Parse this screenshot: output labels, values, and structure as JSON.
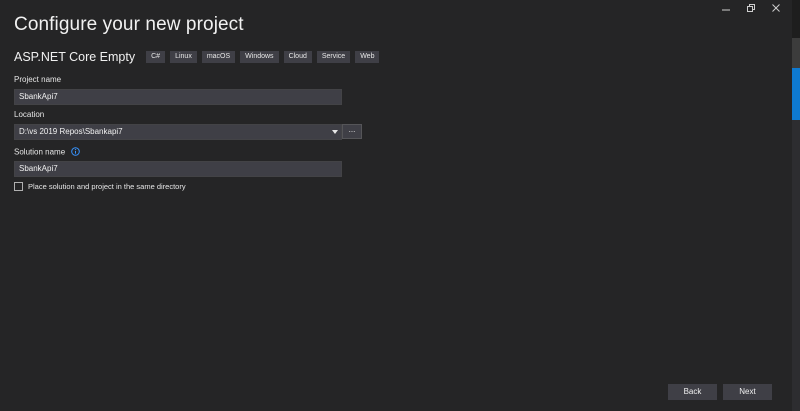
{
  "window": {
    "controls": {
      "minimize_icon": "minimize-icon",
      "maximize_icon": "restore-icon",
      "close_icon": "close-icon"
    }
  },
  "page": {
    "title": "Configure your new project"
  },
  "template": {
    "name": "ASP.NET Core Empty",
    "tags": [
      "C#",
      "Linux",
      "macOS",
      "Windows",
      "Cloud",
      "Service",
      "Web"
    ]
  },
  "form": {
    "project_name": {
      "label": "Project name",
      "value": "SbankApi7"
    },
    "location": {
      "label": "Location",
      "value": "D:\\vs 2019 Repos\\Sbankapi7",
      "browse_label": "..."
    },
    "solution_name": {
      "label": "Solution name",
      "value": "SbankApi7"
    },
    "same_directory": {
      "label": "Place solution and project in the same directory",
      "checked": false
    }
  },
  "footer": {
    "back_label": "Back",
    "next_label": "Next"
  },
  "colors": {
    "background": "#252526",
    "input_bg": "#3f3f46",
    "accent": "#0e7ad1",
    "info_icon": "#3794ff"
  }
}
